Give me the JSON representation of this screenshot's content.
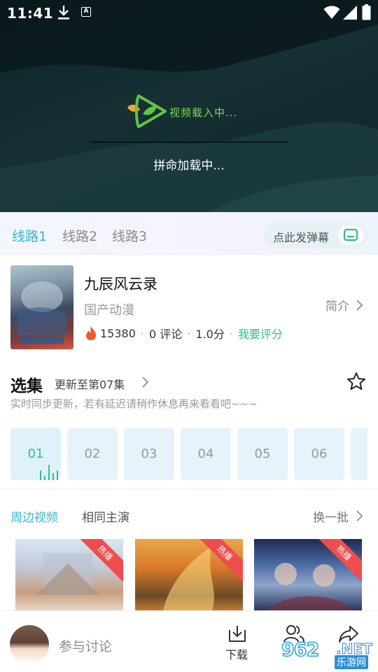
{
  "status_bar": {
    "time": "11:41",
    "a_icon_letter": "A"
  },
  "player": {
    "loading_text": "视频载入中...",
    "loading_sub": "拼命加载中..."
  },
  "routes": {
    "items": [
      "线路1",
      "线路2",
      "线路3"
    ],
    "active_index": 0,
    "danmu_label": "点此发弹幕"
  },
  "info": {
    "title": "九辰风云录",
    "category": "国产动漫",
    "intro_label": "简介",
    "heat": "15380",
    "comments": "0 评论",
    "score": "1.0分",
    "rate_label": "我要评分"
  },
  "episodes": {
    "title": "选集",
    "update": "更新至第07集",
    "note": "实时同步更新，若有延迟请稍作休息再来看看吧~~~",
    "items": [
      "01",
      "02",
      "03",
      "04",
      "05",
      "06",
      ""
    ],
    "active_index": 0
  },
  "related": {
    "tabs": [
      "周边视频",
      "相同主演"
    ],
    "active_index": 0,
    "refresh_label": "换一批",
    "hot_badge": "热播"
  },
  "bottom": {
    "discuss_placeholder": "参与讨论",
    "download_label": "下载"
  },
  "watermark": {
    "number": "962",
    "domain": ".NET",
    "site": "乐游网"
  },
  "colors": {
    "accent": "#39b3d6",
    "green": "#2cc07a",
    "hot": "#ef4d4d",
    "heat_icon": "#f05a28"
  }
}
